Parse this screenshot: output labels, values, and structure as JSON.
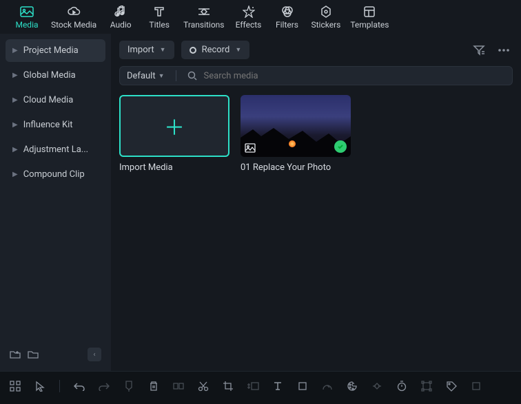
{
  "top_tabs": {
    "media": "Media",
    "stock_media": "Stock Media",
    "audio": "Audio",
    "titles": "Titles",
    "transitions": "Transitions",
    "effects": "Effects",
    "filters": "Filters",
    "stickers": "Stickers",
    "templates": "Templates"
  },
  "sidebar": {
    "items": [
      {
        "label": "Project Media"
      },
      {
        "label": "Global Media"
      },
      {
        "label": "Cloud Media"
      },
      {
        "label": "Influence Kit"
      },
      {
        "label": "Adjustment La..."
      },
      {
        "label": "Compound Clip"
      }
    ]
  },
  "toolbar": {
    "import_label": "Import",
    "record_label": "Record"
  },
  "search": {
    "default_label": "Default",
    "placeholder": "Search media"
  },
  "cards": {
    "import": "Import Media",
    "photo1": "01 Replace Your Photo"
  }
}
